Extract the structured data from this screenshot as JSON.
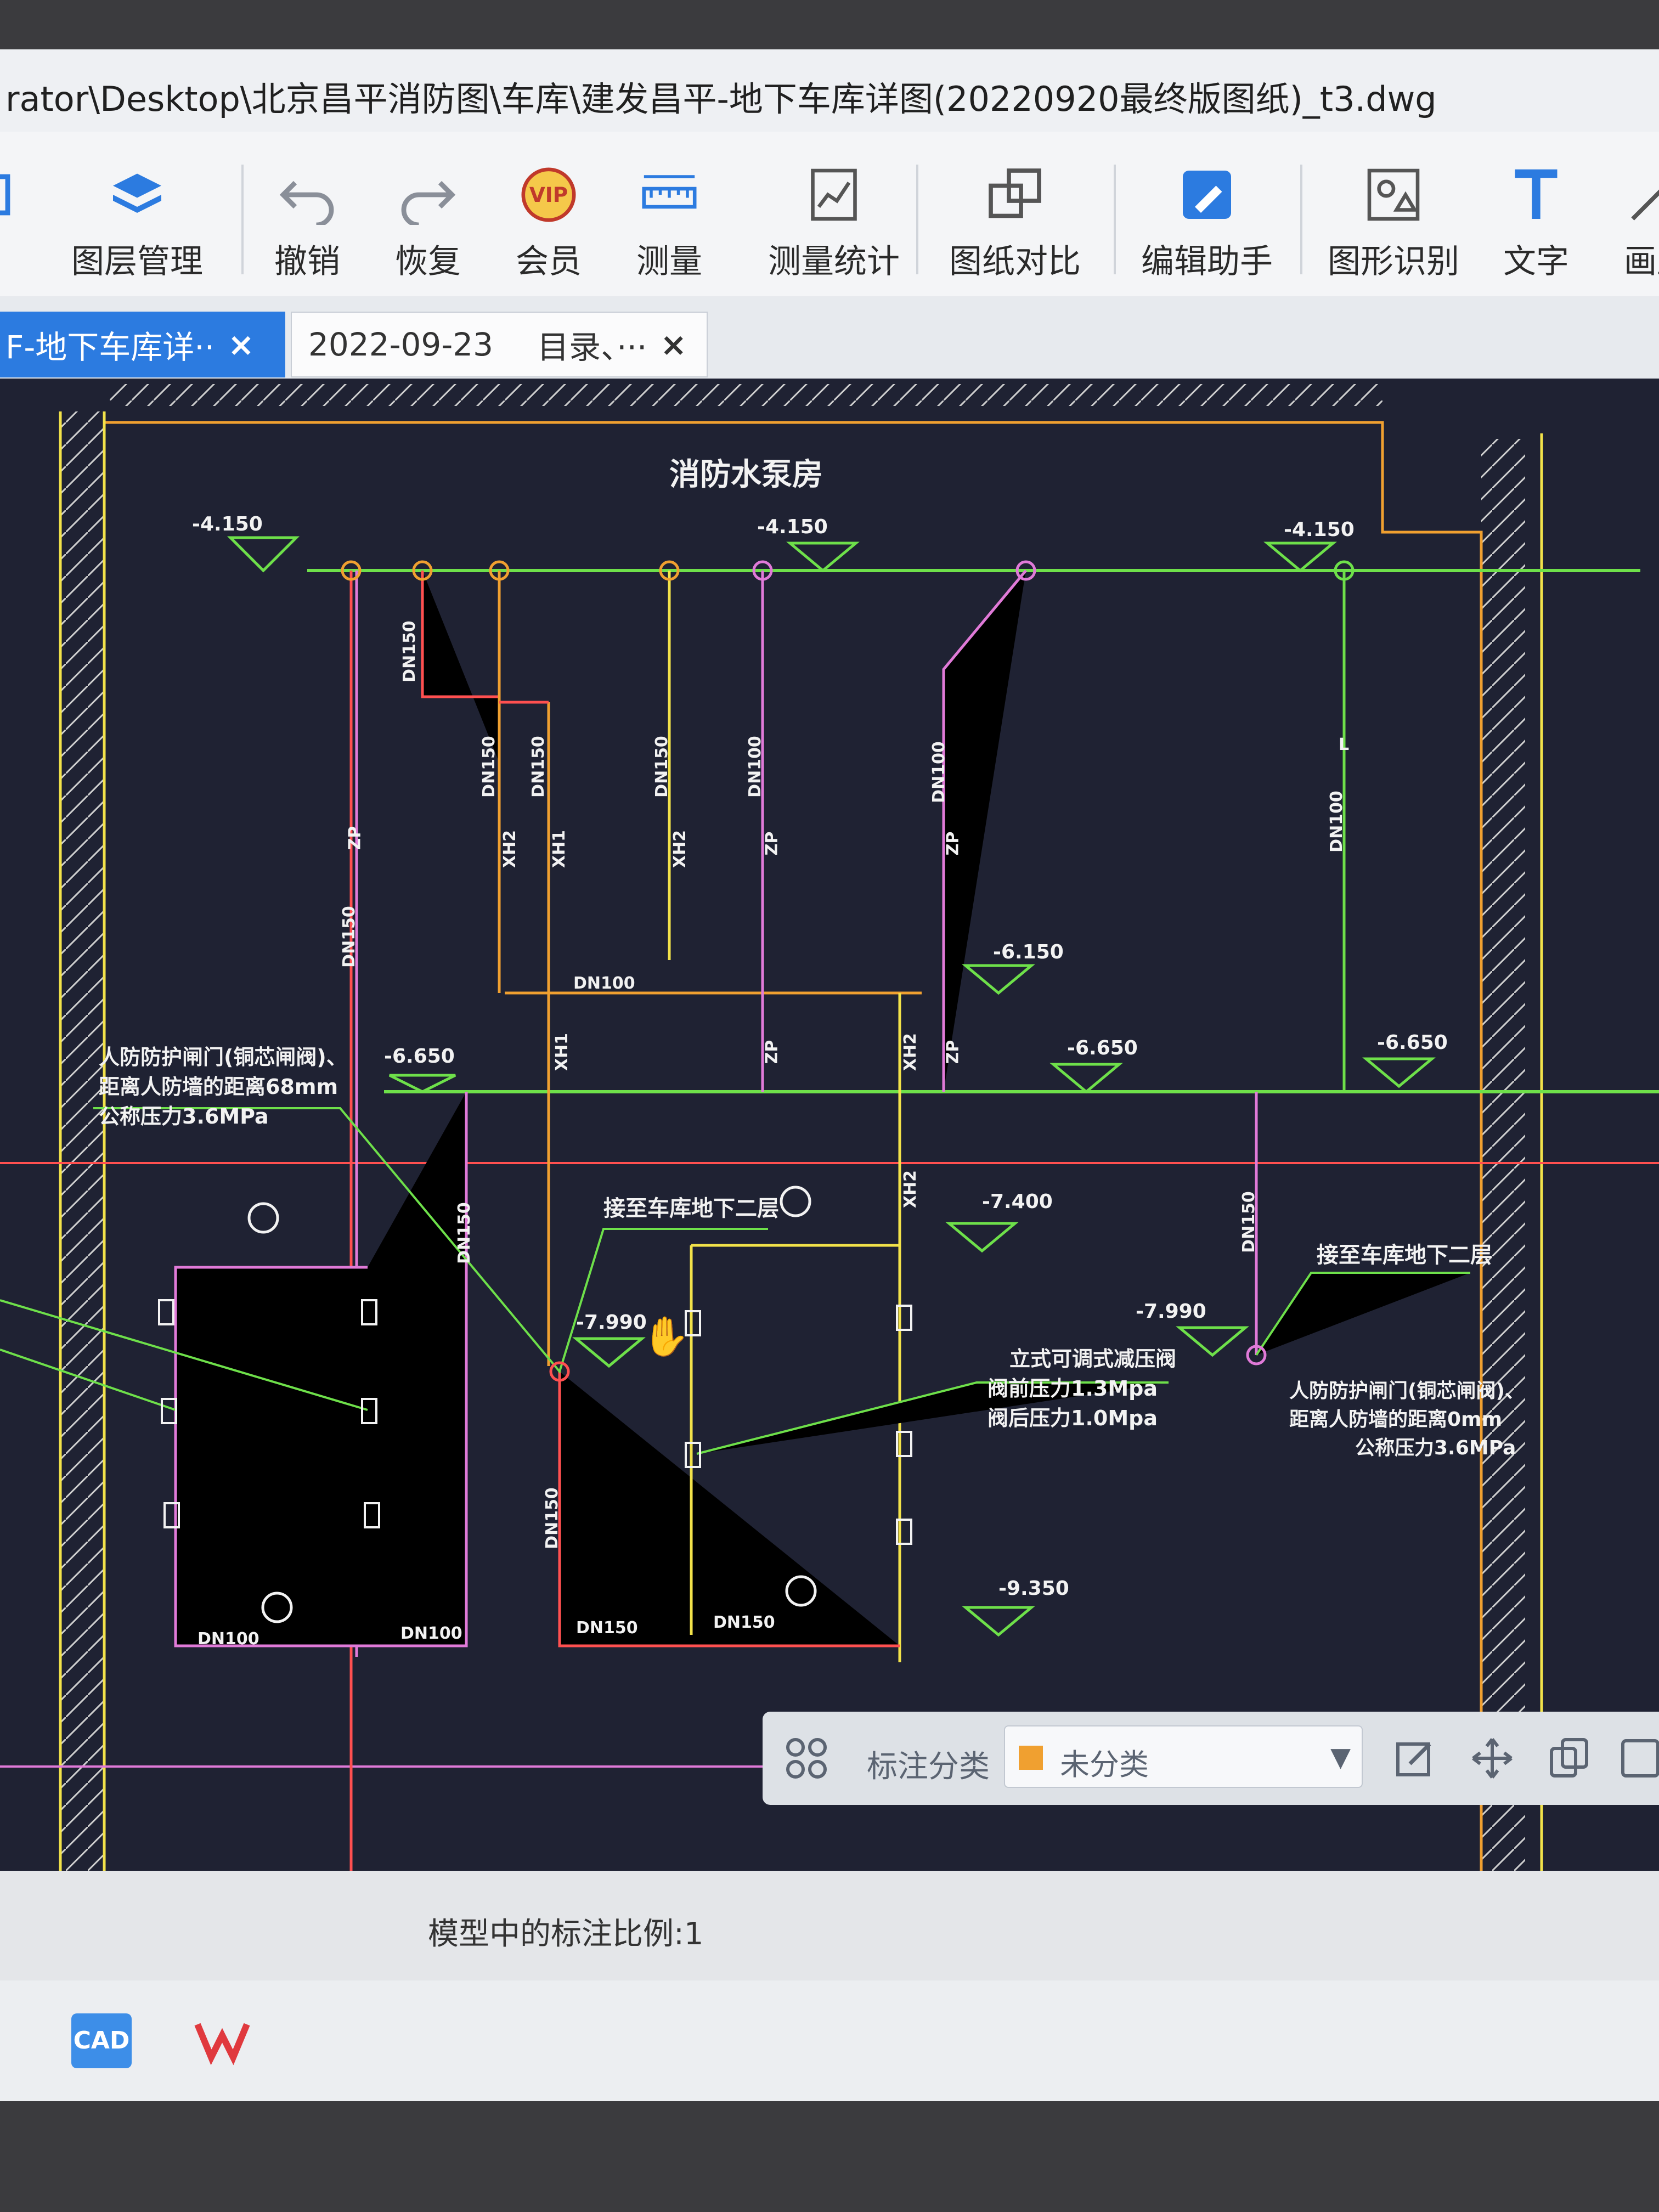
{
  "window": {
    "title": "rator\\Desktop\\北京昌平消防图\\车库\\建发昌平-地下车库详图(20220920最终版图纸)_t3.dwg"
  },
  "toolbar": {
    "items": [
      {
        "label": "口",
        "icon": "partial-icon"
      },
      {
        "label": "图层管理",
        "icon": "layers-icon"
      },
      {
        "label": "撤销",
        "icon": "undo-icon"
      },
      {
        "label": "恢复",
        "icon": "redo-icon"
      },
      {
        "label": "会员",
        "icon": "vip-icon"
      },
      {
        "label": "测量",
        "icon": "ruler-icon"
      },
      {
        "label": "测量统计",
        "icon": "measure-stats-icon"
      },
      {
        "label": "图纸对比",
        "icon": "compare-icon"
      },
      {
        "label": "编辑助手",
        "icon": "edit-assistant-icon"
      },
      {
        "label": "图形识别",
        "icon": "shape-recognize-icon"
      },
      {
        "label": "文字",
        "icon": "text-icon"
      },
      {
        "label": "画直",
        "icon": "draw-line-icon"
      }
    ]
  },
  "tabs": [
    {
      "label": "F-地下车库详··",
      "close": "×",
      "active": true
    },
    {
      "label": "2022-09-23",
      "sub": "目录、···",
      "close": "×",
      "active": false
    }
  ],
  "drawing": {
    "room_title": "消防水泵房",
    "elevations": [
      "-4.150",
      "-4.150",
      "-4.150",
      "-6.150",
      "-6.650",
      "-6.650",
      "-6.650",
      "-7.400",
      "-7.990",
      "-7.990",
      "-9.350"
    ],
    "notes": {
      "left_valve_1": "人防防护闸门(铜芯闸阀)、",
      "left_valve_2": "距离人防墙的距离68mm",
      "left_valve_3": "公称压力3.6MPa",
      "to_garage_1": "接至车库地下二层",
      "to_garage_2": "接至车库地下二层",
      "prv_1": "立式可调式减压阀",
      "prv_2": "阀前压力1.3Mpa",
      "prv_3": "阀后压力1.0Mpa",
      "right_valve_1": "人防防护闸门(铜芯闸阀)、",
      "right_valve_2": "距离人防墙的距离0mm",
      "right_valve_3": "公称压力3.6MPa"
    },
    "pipe_labels": [
      "DN150",
      "DN150",
      "DN150",
      "DN150",
      "DN100",
      "DN100",
      "DN150",
      "DN100",
      "DN100",
      "DN150",
      "DN150",
      "DN150",
      "DN100",
      "DN100",
      "DN150",
      "DN150"
    ],
    "pipe_codes": [
      "ZP",
      "XH2",
      "XH1",
      "XH2",
      "ZP",
      "ZP",
      "XH1",
      "ZP",
      "XH2",
      "ZP",
      "XH2",
      "L"
    ]
  },
  "annotation_panel": {
    "label": "标注分类",
    "selected": "未分类",
    "swatch_color": "#f0a030"
  },
  "status": {
    "scale_text": "模型中的标注比例:1"
  },
  "taskbar": {
    "apps": [
      {
        "name": "CAD",
        "icon": "cad-app-icon"
      },
      {
        "name": "WPS",
        "icon": "wps-app-icon"
      }
    ]
  },
  "colors": {
    "canvas_bg": "#1f2233",
    "green": "#6ee04a",
    "pink": "#e07ad8",
    "orange": "#f0a030",
    "red": "#ff5050",
    "yellow": "#f2e24a",
    "white": "#f2f2f2",
    "accent_tab": "#2c7be0"
  }
}
